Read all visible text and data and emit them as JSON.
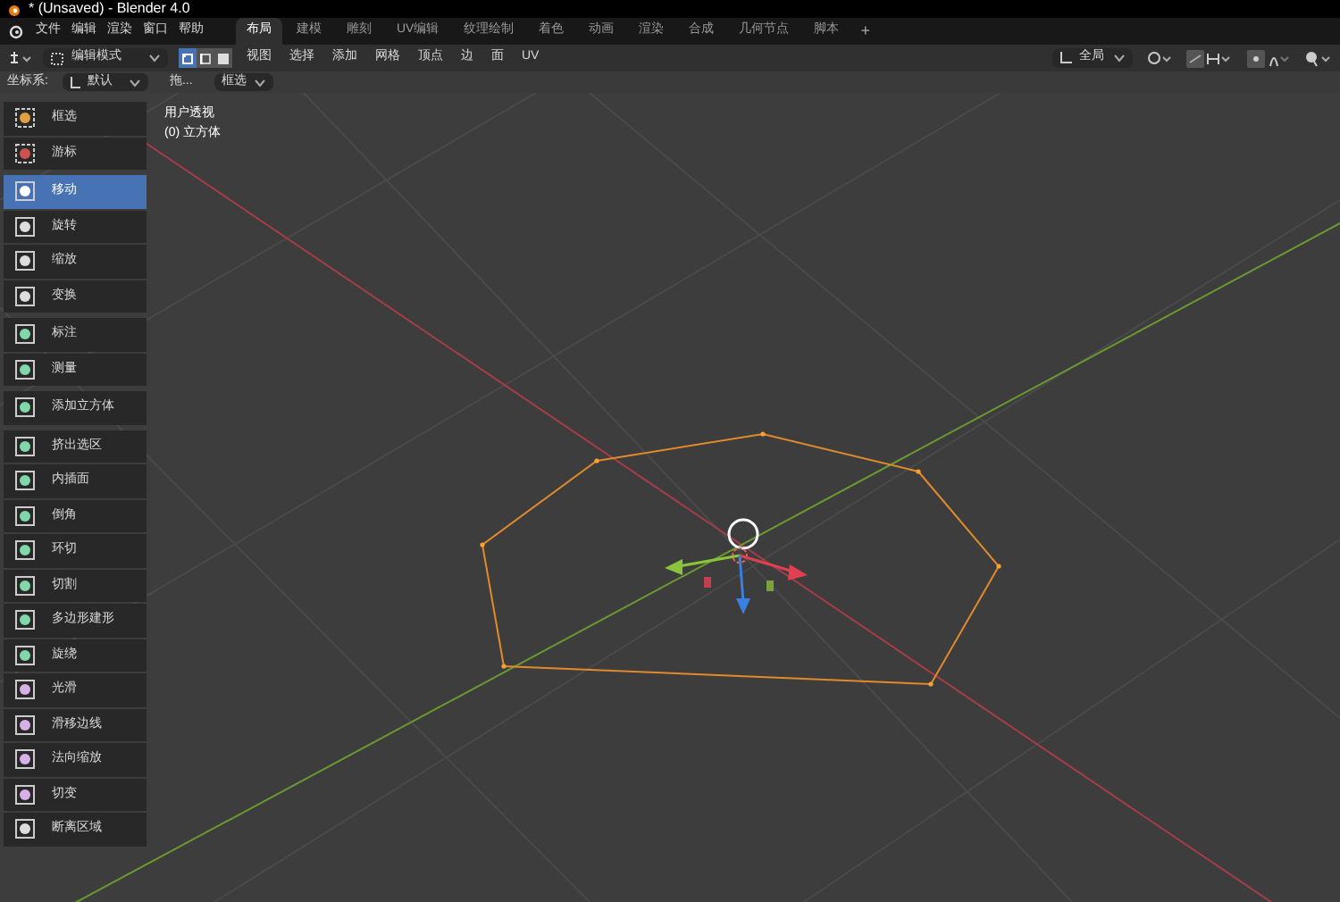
{
  "window": {
    "title": "* (Unsaved) - Blender 4.0"
  },
  "menus": [
    "文件",
    "编辑",
    "渲染",
    "窗口",
    "帮助"
  ],
  "workspaces": [
    {
      "label": "布局",
      "selected": true
    },
    {
      "label": "建模",
      "selected": false
    },
    {
      "label": "雕刻",
      "selected": false
    },
    {
      "label": "UV编辑",
      "selected": false
    },
    {
      "label": "纹理绘制",
      "selected": false
    },
    {
      "label": "着色",
      "selected": false
    },
    {
      "label": "动画",
      "selected": false
    },
    {
      "label": "渲染",
      "selected": false
    },
    {
      "label": "合成",
      "selected": false
    },
    {
      "label": "几何节点",
      "selected": false
    },
    {
      "label": "脚本",
      "selected": false
    }
  ],
  "add_workspace": "+",
  "header": {
    "mode": "编辑模式",
    "select_modes": [
      {
        "kind": "vertex",
        "selected": true
      },
      {
        "kind": "edge",
        "selected": false
      },
      {
        "kind": "face",
        "selected": false
      }
    ],
    "menus": [
      "视图",
      "选择",
      "添加",
      "网格",
      "顶点",
      "边",
      "面",
      "UV"
    ],
    "orientation": "全局"
  },
  "tool_settings": {
    "label": "坐标系:",
    "orientation": "默认",
    "drag": "拖...",
    "select": "框选"
  },
  "overlay": {
    "view": "用户透视",
    "object": "(0) 立方体"
  },
  "toolbar": [
    [
      {
        "kind": "select",
        "label": "框选",
        "selected": false
      },
      {
        "kind": "cursor",
        "label": "游标",
        "selected": false
      }
    ],
    [
      {
        "kind": "move",
        "label": "移动",
        "selected": true
      },
      {
        "kind": "rotate",
        "label": "旋转",
        "selected": false
      },
      {
        "kind": "scale",
        "label": "缩放",
        "selected": false
      },
      {
        "kind": "transform",
        "label": "变换",
        "selected": false
      }
    ],
    [
      {
        "kind": "annotate",
        "label": "标注",
        "selected": false
      },
      {
        "kind": "measure",
        "label": "测量",
        "selected": false
      }
    ],
    [
      {
        "kind": "addcube",
        "label": "添加立方体",
        "selected": false
      }
    ],
    [
      {
        "kind": "extrude",
        "label": "挤出选区",
        "selected": false
      },
      {
        "kind": "inset",
        "label": "内插面",
        "selected": false
      },
      {
        "kind": "bevel",
        "label": "倒角",
        "selected": false
      },
      {
        "kind": "loopcut",
        "label": "环切",
        "selected": false
      },
      {
        "kind": "knife",
        "label": "切割",
        "selected": false
      },
      {
        "kind": "polybuild",
        "label": "多边形建形",
        "selected": false
      },
      {
        "kind": "spin",
        "label": "旋绕",
        "selected": false
      },
      {
        "kind": "smooth",
        "label": "光滑",
        "selected": false
      },
      {
        "kind": "edgeslide",
        "label": "滑移边线",
        "selected": false
      },
      {
        "kind": "shrink",
        "label": "法向缩放",
        "selected": false
      },
      {
        "kind": "shear",
        "label": "切变",
        "selected": false
      },
      {
        "kind": "rip",
        "label": "断离区域",
        "selected": false
      }
    ]
  ]
}
